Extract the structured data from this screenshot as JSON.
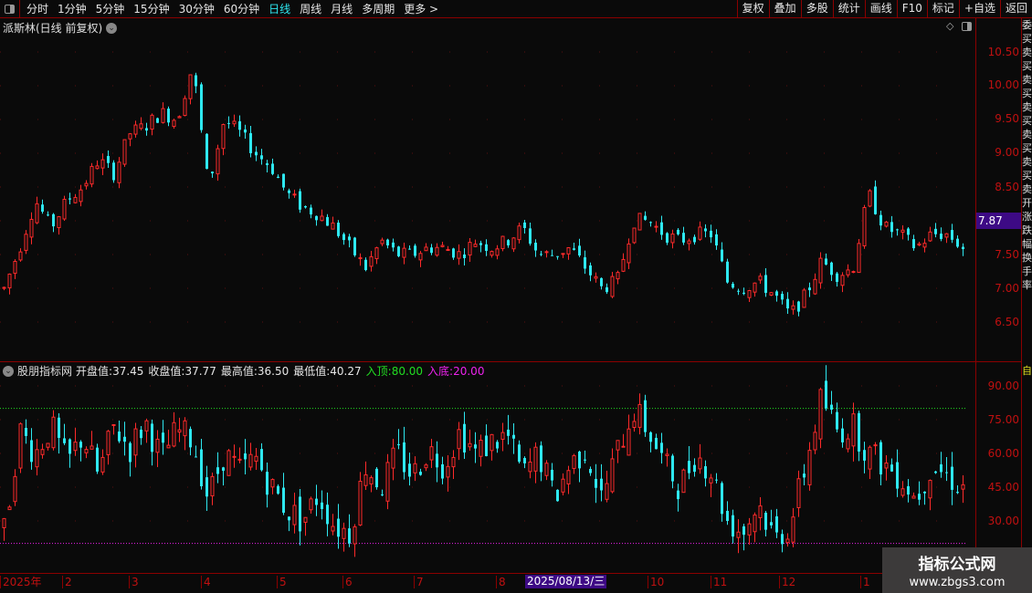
{
  "toolbar": {
    "periods": [
      "分时",
      "1分钟",
      "5分钟",
      "15分钟",
      "30分钟",
      "60分钟",
      "日线",
      "周线",
      "月线",
      "多周期",
      "更多 >"
    ],
    "active_period": "日线",
    "right_buttons": [
      "复权",
      "叠加",
      "多股",
      "统计",
      "画线",
      "F10",
      "标记",
      "+自选",
      "返回"
    ]
  },
  "main": {
    "title": "派斯林(日线 前复权)",
    "price_labels": [
      "10.50",
      "10.00",
      "9.50",
      "9.00",
      "8.50",
      "7.50",
      "7.00",
      "6.50"
    ],
    "current_price": "7.87",
    "side_strip": "委买卖买卖买卖买卖买卖买卖开涨跌幅换手率"
  },
  "indicator": {
    "name": "股朋指标网",
    "fields": [
      {
        "label": "开盘值:",
        "value": "37.45",
        "color": "#e6e6e6"
      },
      {
        "label": "收盘值:",
        "value": "37.77",
        "color": "#e6e6e6"
      },
      {
        "label": "最高值:",
        "value": "36.50",
        "color": "#e6e6e6"
      },
      {
        "label": "最低值:",
        "value": "40.27",
        "color": "#e6e6e6"
      },
      {
        "label": "入顶:",
        "value": "80.00",
        "color": "#22dd22"
      },
      {
        "label": "入底:",
        "value": "20.00",
        "color": "#ee22ee"
      }
    ],
    "axis_labels": [
      "90.00",
      "75.00",
      "60.00",
      "45.00",
      "30.00"
    ],
    "side_top": "自"
  },
  "date_axis": {
    "labels": [
      "2025年",
      "2",
      "3",
      "4",
      "5",
      "6",
      "7",
      "8",
      "10",
      "11",
      "12",
      "1"
    ],
    "cursor_date": "2025/08/13/三"
  },
  "watermark": {
    "line1": "指标公式网",
    "line2": "www.zbgs3.com"
  },
  "colors": {
    "up": "#ff2a2a",
    "down": "#2ee8f0",
    "border": "#8b0000",
    "top_line": "#22dd22",
    "bottom_line": "#ee22ee",
    "cursor_bg": "#3d0a85"
  },
  "chart_data": {
    "type": "candlestick",
    "price_ylim": [
      6.2,
      10.9
    ],
    "price_path": [
      7.0,
      7.6,
      8.3,
      7.9,
      8.3,
      8.5,
      8.9,
      8.7,
      9.3,
      9.4,
      9.6,
      9.5,
      10.3,
      8.5,
      9.5,
      9.3,
      9.0,
      8.8,
      8.4,
      8.2,
      8.1,
      7.9,
      7.6,
      7.3,
      7.7,
      7.5,
      7.5,
      7.6,
      7.6,
      7.5,
      7.7,
      7.6,
      7.7,
      7.9,
      7.5,
      7.5,
      7.6,
      7.3,
      7.0,
      7.1,
      8.0,
      8.0,
      7.8,
      7.7,
      7.8,
      7.8,
      7.1,
      7.0,
      7.1,
      6.9,
      6.6,
      6.9,
      7.4,
      7.2,
      7.3,
      8.4,
      7.9,
      7.8,
      7.6,
      7.8,
      7.8,
      7.6
    ],
    "indicator_ylim": [
      15,
      95
    ],
    "indicator_path": [
      25,
      70,
      60,
      72,
      55,
      68,
      50,
      72,
      62,
      74,
      58,
      70,
      66,
      40,
      60,
      52,
      58,
      45,
      35,
      30,
      42,
      28,
      25,
      55,
      45,
      60,
      50,
      62,
      55,
      70,
      60,
      65,
      68,
      50,
      60,
      40,
      55,
      62,
      40,
      60,
      80,
      70,
      55,
      45,
      60,
      52,
      30,
      25,
      38,
      22,
      28,
      55,
      85,
      70,
      72,
      60,
      55,
      50,
      40,
      55,
      50,
      45
    ],
    "top_line": 80,
    "bottom_line": 20
  }
}
